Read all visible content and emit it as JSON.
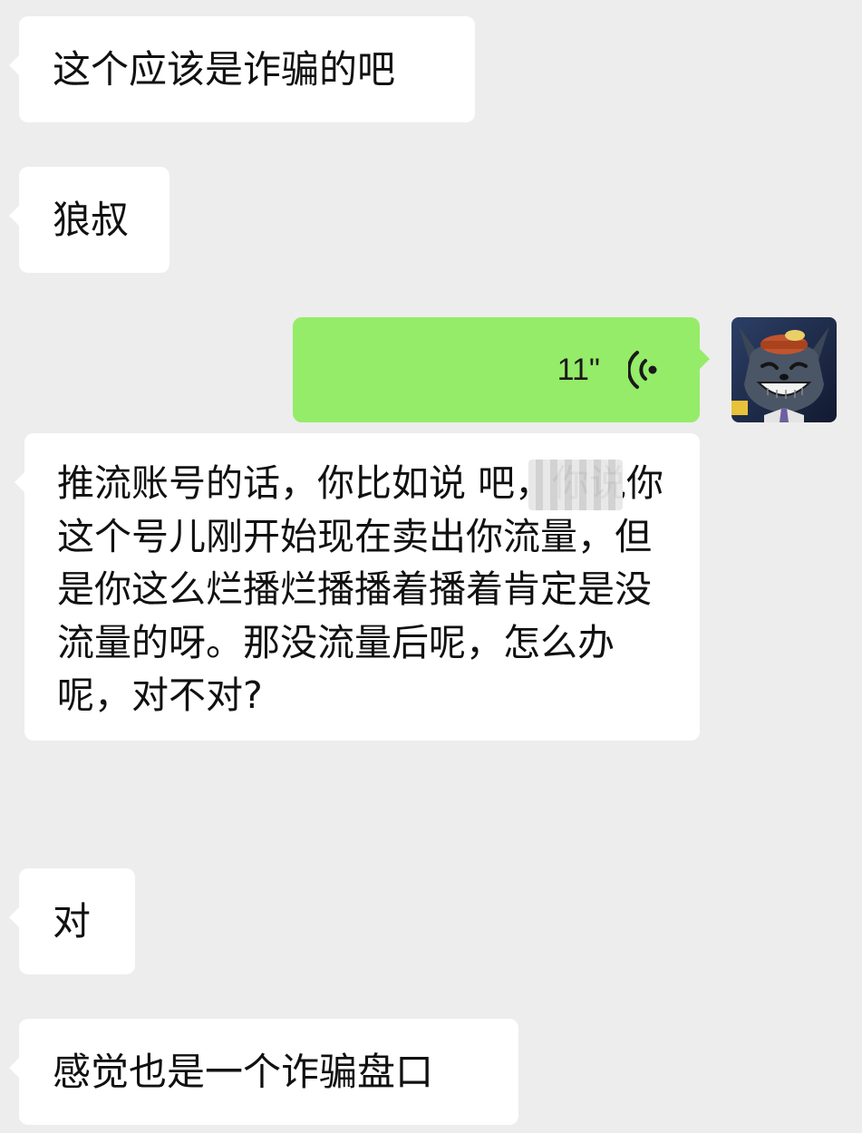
{
  "messages": [
    {
      "side": "left",
      "type": "text",
      "text": "这个应该是诈骗的吧"
    },
    {
      "side": "left",
      "type": "text",
      "text": "狼叔"
    },
    {
      "side": "right",
      "type": "voice",
      "duration": "11\"",
      "icon": "voice-waves-icon"
    },
    {
      "side": "left",
      "type": "transcript",
      "text": "推流账号的话，你比如说  吧，你说你这个号儿刚开始现在卖出你流量，但是你这么烂播烂播播着播着肯定是没流量的呀。那没流量后呢，怎么办呢，对不对?"
    },
    {
      "side": "left",
      "type": "text",
      "text": "对"
    },
    {
      "side": "left",
      "type": "text",
      "text": "感觉也是一个诈骗盘口"
    }
  ],
  "avatar": {
    "icon": "wolf-avatar"
  },
  "colors": {
    "background": "#ededed",
    "incoming_bubble": "#ffffff",
    "outgoing_bubble": "#95ec69",
    "voice_icon": "#1a1a1a"
  }
}
